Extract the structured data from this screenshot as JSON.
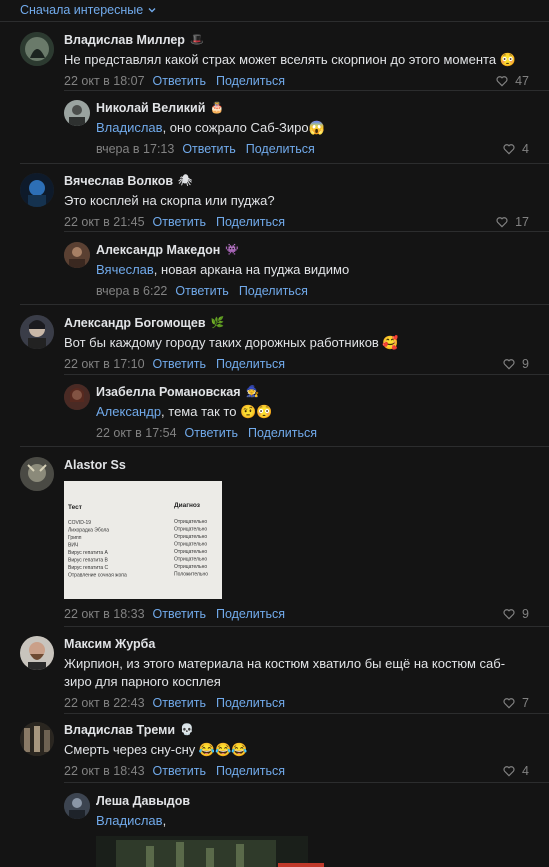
{
  "sort": {
    "label": "Сначала интересные"
  },
  "comments": [
    {
      "author": "Владислав Миллер",
      "badge": "🎩",
      "text": "Не представлял какой страх может вселять скорпион до этого момента 😳",
      "date": "22 окт в 18:07",
      "reply": "Ответить",
      "share": "Поделиться",
      "likes": "47"
    },
    {
      "author": "Николай Великий",
      "badge": "🎂",
      "mention": "Владислав",
      "text": ", оно сожрало Саб-Зиро😱",
      "date": "вчера в 17:13",
      "reply": "Ответить",
      "share": "Поделиться",
      "likes": "4"
    },
    {
      "author": "Вячеслав Волков",
      "badge": "🕷",
      "text": "Это косплей на скорпа или пуджа?",
      "date": "22 окт в 21:45",
      "reply": "Ответить",
      "share": "Поделиться",
      "likes": "17"
    },
    {
      "author": "Александр Македон",
      "badge": "👾",
      "mention": "Вячеслав",
      "text": ", новая аркана на пуджа видимо",
      "date": "вчера в 6:22",
      "reply": "Ответить",
      "share": "Поделиться",
      "likes": ""
    },
    {
      "author": "Александр Богомощев",
      "badge": "🌿",
      "text": "Вот бы каждому городу таких дорожных работников 🥰",
      "date": "22 окт в 17:10",
      "reply": "Ответить",
      "share": "Поделиться",
      "likes": "9"
    },
    {
      "author": "Изабелла Романовская",
      "badge": "🧙",
      "mention": "Александр",
      "text": ", тема так то 🤨😳",
      "date": "22 окт в 17:54",
      "reply": "Ответить",
      "share": "Поделиться",
      "likes": ""
    },
    {
      "author": "Alastor Ss",
      "badge": "",
      "text": "",
      "photo": {
        "header_left": "Тест",
        "header_right": "Диагноз",
        "rows": [
          [
            "COVID-19",
            "Отрицательно"
          ],
          [
            "Лихорадка Эбола",
            "Отрицательно"
          ],
          [
            "Грипп",
            "Отрицательно"
          ],
          [
            "ВИЧ",
            "Отрицательно"
          ],
          [
            "Вирус гепатита А",
            "Отрицательно"
          ],
          [
            "Вирус гепатита В",
            "Отрицательно"
          ],
          [
            "Вирус гепатита С",
            "Отрицательно"
          ],
          [
            "Отравление сочная жопа",
            "Положительно"
          ]
        ]
      },
      "date": "22 окт в 18:33",
      "reply": "Ответить",
      "share": "Поделиться",
      "likes": "9"
    },
    {
      "author": "Максим Журба",
      "badge": "",
      "text": "Жирпион, из этого материала на костюм хватило бы ещё на костюм саб-зиро для парного косплея",
      "date": "22 окт в 22:43",
      "reply": "Ответить",
      "share": "Поделиться",
      "likes": "7"
    },
    {
      "author": "Владислав Треми",
      "badge": "💀",
      "text": "Смерть через сну-сну 😂😂😂",
      "date": "22 окт в 18:43",
      "reply": "Ответить",
      "share": "Поделиться",
      "likes": "4"
    },
    {
      "author": "Леша Давыдов",
      "badge": "",
      "mention": "Владислав",
      "text": ",",
      "date": "",
      "reply": "",
      "share": "",
      "likes": ""
    }
  ],
  "colors": {
    "background": "#141414",
    "accent": "#71aaeb",
    "muted": "#828282",
    "text": "#e1e3e6"
  }
}
